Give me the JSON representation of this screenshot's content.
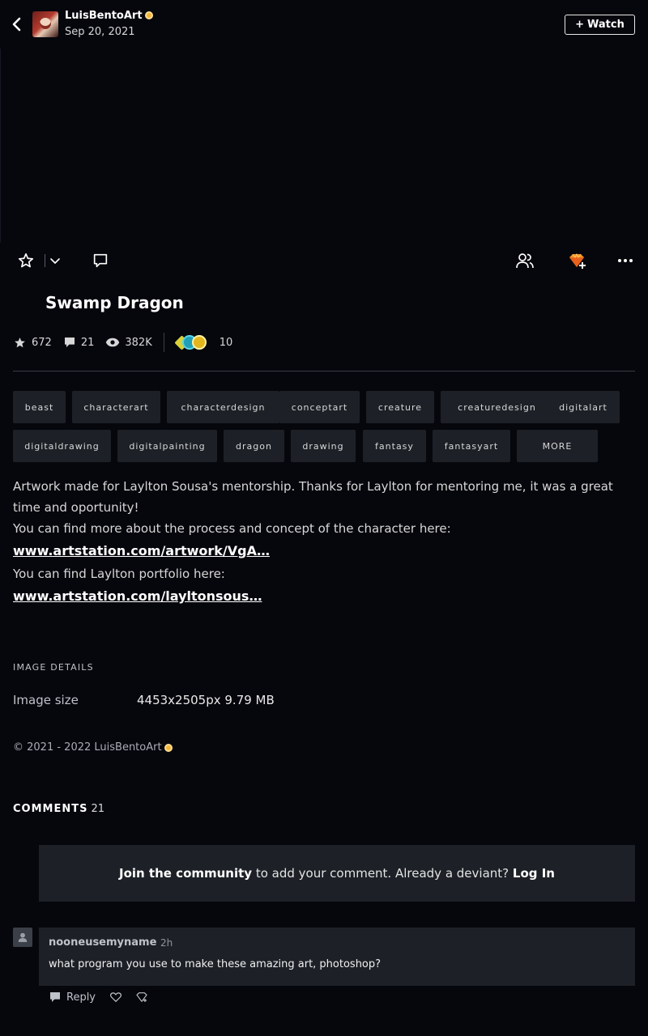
{
  "header": {
    "username": "LuisBentoArt",
    "date": "Sep 20, 2021",
    "watch_label": "Watch",
    "watch_icon": "+"
  },
  "actions": {
    "icons": [
      "star-icon",
      "chevron-down-icon",
      "comment-icon",
      "group-icon",
      "gift-gem-icon",
      "more-icon"
    ]
  },
  "artwork": {
    "title": "Swamp Dragon"
  },
  "stats": {
    "favourites": "672",
    "comments": "21",
    "views": "382K",
    "awards": "10"
  },
  "tags": [
    "beast",
    "characterart",
    "characterdesign",
    "conceptart",
    "creature",
    "creaturedesign",
    "digitalart",
    "digitaldrawing",
    "digitalpainting",
    "dragon",
    "drawing",
    "fantasy",
    "fantasyart"
  ],
  "tags_more_label": "MORE",
  "description": {
    "line1": "Artwork made for Laylton Sousa's mentorship. Thanks for Laylton for mentoring me, it was a great time and oportunity!",
    "line2": "You can find more about the process and concept of the character here:",
    "link1": "www.artstation.com/artwork/VgA…",
    "line3": "You can find Laylton portfolio here:",
    "link2": "www.artstation.com/layltonsous…"
  },
  "details": {
    "heading": "IMAGE DETAILS",
    "size_label": "Image size",
    "size_value": "4453x2505px 9.79 MB"
  },
  "copyright": "© 2021 - 2022 LuisBentoArt",
  "comments_section": {
    "heading": "COMMENTS",
    "count": "21",
    "join_bold": "Join the community",
    "join_text": " to add your comment. Already a deviant? ",
    "login_label": "Log In"
  },
  "comments": [
    {
      "author": "nooneusemyname",
      "time": "2h",
      "text": "what program you use to make these amazing art, photoshop?",
      "reply_label": "Reply"
    }
  ],
  "colors": {
    "background": "#06070d",
    "surface": "#1d2127",
    "accent_gem": "#f7941d",
    "core_badge": "#f2b541"
  }
}
